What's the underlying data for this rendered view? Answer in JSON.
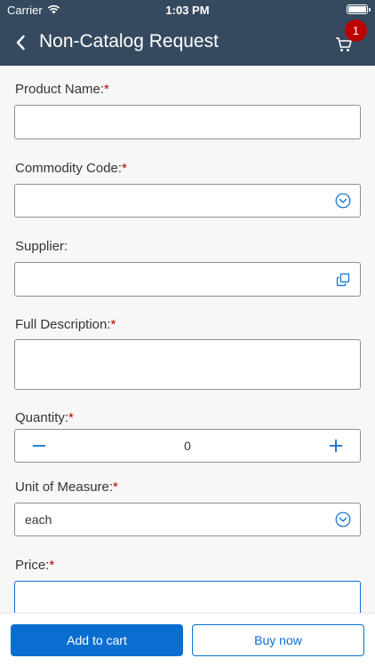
{
  "status_bar": {
    "carrier": "Carrier",
    "time": "1:03 PM"
  },
  "nav": {
    "title": "Non-Catalog Request",
    "cart_badge": "1"
  },
  "form": {
    "required_marker": "*",
    "product_name": {
      "label": "Product Name:",
      "value": ""
    },
    "commodity_code": {
      "label": "Commodity Code:",
      "value": ""
    },
    "supplier": {
      "label": "Supplier:",
      "value": ""
    },
    "full_description": {
      "label": "Full Description:",
      "value": ""
    },
    "quantity": {
      "label": "Quantity:",
      "value": "0"
    },
    "unit_of_measure": {
      "label": "Unit of Measure:",
      "value": "each"
    },
    "price": {
      "label": "Price:",
      "value": ""
    }
  },
  "footer": {
    "add_to_cart": "Add to cart",
    "buy_now": "Buy now"
  },
  "colors": {
    "header": "#354a5f",
    "accent": "#0a6ed1",
    "required": "#bb0000"
  }
}
